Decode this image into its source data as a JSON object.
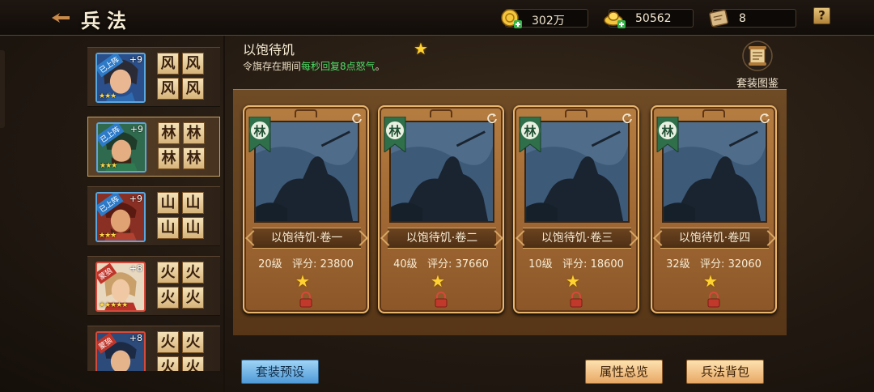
{
  "header": {
    "title": "兵法",
    "coins": "302万",
    "ingots": "50562",
    "scrolls": "8",
    "help": "?"
  },
  "heroes": [
    {
      "tag": "已上阵",
      "level": "+9",
      "stars": "★★★",
      "glyphs": [
        "风",
        "风",
        "风",
        "风"
      ],
      "selected": false
    },
    {
      "tag": "已上阵",
      "level": "+9",
      "stars": "★★★",
      "glyphs": [
        "林",
        "林",
        "林",
        "林"
      ],
      "selected": true
    },
    {
      "tag": "已上阵",
      "level": "+9",
      "stars": "★★★",
      "glyphs": [
        "山",
        "山",
        "山",
        "山"
      ],
      "selected": false
    },
    {
      "tag": "蒙狼",
      "level": "+8",
      "stars": "★★★★★",
      "glyphs": [
        "火",
        "火",
        "火",
        "火"
      ],
      "selected": false
    },
    {
      "tag": "蒙狼",
      "level": "+8",
      "stars": "",
      "glyphs": [
        "火",
        "火",
        "火",
        "火"
      ],
      "selected": false
    }
  ],
  "skill": {
    "name": "以饱待饥",
    "desc_prefix": "令旗存在期间",
    "desc_highlight": "每秒回复8点怒气",
    "desc_suffix": "。"
  },
  "suit_gallery_label": "套装图鉴",
  "cards": [
    {
      "badge": "林",
      "name": "以饱待饥·卷一",
      "level": "20级",
      "score_label": "评分:",
      "score": "23800"
    },
    {
      "badge": "林",
      "name": "以饱待饥·卷二",
      "level": "40级",
      "score_label": "评分:",
      "score": "37660"
    },
    {
      "badge": "林",
      "name": "以饱待饥·卷三",
      "level": "10级",
      "score_label": "评分:",
      "score": "18600"
    },
    {
      "badge": "林",
      "name": "以饱待饥·卷四",
      "level": "32级",
      "score_label": "评分:",
      "score": "32060"
    }
  ],
  "buttons": {
    "preset": "套装预设",
    "overview": "属性总览",
    "bag": "兵法背包"
  },
  "colors": {
    "accent_gold": "#e8b56e",
    "highlight_green": "#4ee06a",
    "star_yellow": "#ffd233"
  }
}
